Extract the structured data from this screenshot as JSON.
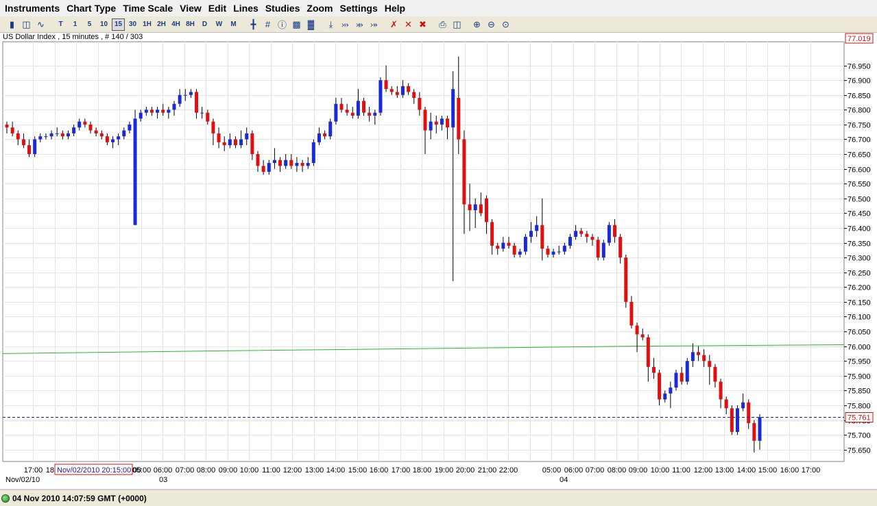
{
  "menu": [
    "Instruments",
    "Chart Type",
    "Time Scale",
    "View",
    "Edit",
    "Lines",
    "Studies",
    "Zoom",
    "Settings",
    "Help"
  ],
  "toolbar": {
    "timescale_buttons": [
      "T",
      "1",
      "5",
      "10",
      "15",
      "30",
      "1H",
      "2H",
      "4H",
      "8H",
      "D",
      "W",
      "M"
    ],
    "active_timescale": "15"
  },
  "chart_header": "US Dollar Index , 15 minutes , # 140 / 303",
  "status": {
    "text": "04 Nov 2010 14:07:59  GMT (+0000)"
  },
  "chart_data": {
    "type": "candlestick",
    "title": "US Dollar Index , 15 minutes , # 140 / 303",
    "ylim": [
      75.61,
      77.03
    ],
    "y_ticks": [
      76.95,
      76.9,
      76.85,
      76.8,
      76.75,
      76.7,
      76.65,
      76.6,
      76.55,
      76.5,
      76.45,
      76.4,
      76.35,
      76.3,
      76.25,
      76.2,
      76.15,
      76.1,
      76.05,
      76.0,
      75.95,
      75.9,
      75.85,
      75.8,
      75.75,
      75.7,
      75.65
    ],
    "x_ticks": [
      "17:00",
      "18:00",
      "",
      "",
      "",
      "05:00",
      "06:00",
      "07:00",
      "08:00",
      "09:00",
      "10:00",
      "11:00",
      "12:00",
      "13:00",
      "14:00",
      "15:00",
      "16:00",
      "17:00",
      "18:00",
      "19:00",
      "20:00",
      "21:00",
      "22:00",
      "",
      "05:00",
      "06:00",
      "07:00",
      "08:00",
      "09:00",
      "10:00",
      "11:00",
      "12:00",
      "13:00",
      "14:00",
      "15:00",
      "16:00",
      "17:00"
    ],
    "x_ticks_visible_partial": "00",
    "date_labels": [
      {
        "label": "Nov/02/10"
      },
      {
        "label": "03"
      },
      {
        "label": "04"
      }
    ],
    "cursor_label": "Nov/02/2010 20:15:00",
    "last_price": "75.761",
    "top_price": "77.019",
    "last_price_value": 75.761,
    "moving_average_color": "#22bb22",
    "moving_average": [
      75.975,
      75.984,
      75.992,
      76.0,
      76.005
    ],
    "up_color": "#1a2bd6",
    "down_color": "#e01010",
    "candles": [
      [
        76.75,
        76.76,
        76.72,
        76.74
      ],
      [
        76.74,
        76.76,
        76.71,
        76.72
      ],
      [
        76.72,
        76.73,
        76.68,
        76.7
      ],
      [
        76.7,
        76.72,
        76.67,
        76.68
      ],
      [
        76.68,
        76.7,
        76.64,
        76.65
      ],
      [
        76.65,
        76.71,
        76.64,
        76.7
      ],
      [
        76.7,
        76.72,
        76.69,
        76.71
      ],
      [
        76.71,
        76.72,
        76.7,
        76.71
      ],
      [
        76.71,
        76.73,
        76.7,
        76.72
      ],
      [
        76.72,
        76.74,
        76.71,
        76.72
      ],
      [
        76.72,
        76.73,
        76.7,
        76.71
      ],
      [
        76.71,
        76.73,
        76.7,
        76.72
      ],
      [
        76.72,
        76.75,
        76.71,
        76.74
      ],
      [
        76.74,
        76.77,
        76.73,
        76.76
      ],
      [
        76.76,
        76.77,
        76.74,
        76.75
      ],
      [
        76.75,
        76.76,
        76.72,
        76.73
      ],
      [
        76.73,
        76.74,
        76.71,
        76.72
      ],
      [
        76.72,
        76.73,
        76.7,
        76.71
      ],
      [
        76.71,
        76.72,
        76.68,
        76.69
      ],
      [
        76.69,
        76.71,
        76.67,
        76.7
      ],
      [
        76.7,
        76.72,
        76.68,
        76.71
      ],
      [
        76.71,
        76.74,
        76.7,
        76.73
      ],
      [
        76.73,
        76.76,
        76.72,
        76.75
      ],
      [
        76.41,
        76.8,
        76.41,
        76.77
      ],
      [
        76.77,
        76.8,
        76.76,
        76.79
      ],
      [
        76.79,
        76.81,
        76.78,
        76.8
      ],
      [
        76.8,
        76.81,
        76.78,
        76.79
      ],
      [
        76.79,
        76.81,
        76.77,
        76.8
      ],
      [
        76.8,
        76.82,
        76.78,
        76.79
      ],
      [
        76.79,
        76.81,
        76.77,
        76.8
      ],
      [
        76.8,
        76.83,
        76.78,
        76.82
      ],
      [
        76.82,
        76.87,
        76.81,
        76.85
      ],
      [
        76.85,
        76.87,
        76.83,
        76.85
      ],
      [
        76.85,
        76.87,
        76.84,
        76.86
      ],
      [
        76.86,
        76.87,
        76.77,
        76.79
      ],
      [
        76.79,
        76.81,
        76.77,
        76.79
      ],
      [
        76.79,
        76.8,
        76.75,
        76.76
      ],
      [
        76.76,
        76.77,
        76.68,
        76.72
      ],
      [
        76.72,
        76.74,
        76.67,
        76.69
      ],
      [
        76.69,
        76.71,
        76.66,
        76.68
      ],
      [
        76.68,
        76.72,
        76.67,
        76.7
      ],
      [
        76.7,
        76.71,
        76.67,
        76.68
      ],
      [
        76.68,
        76.73,
        76.67,
        76.7
      ],
      [
        76.7,
        76.74,
        76.68,
        76.72
      ],
      [
        76.72,
        76.73,
        76.63,
        76.65
      ],
      [
        76.65,
        76.66,
        76.59,
        76.61
      ],
      [
        76.61,
        76.63,
        76.58,
        76.59
      ],
      [
        76.59,
        76.63,
        76.58,
        76.62
      ],
      [
        76.62,
        76.67,
        76.6,
        76.63
      ],
      [
        76.63,
        76.64,
        76.59,
        76.61
      ],
      [
        76.61,
        76.65,
        76.6,
        76.63
      ],
      [
        76.63,
        76.65,
        76.6,
        76.61
      ],
      [
        76.61,
        76.64,
        76.59,
        76.62
      ],
      [
        76.62,
        76.63,
        76.59,
        76.61
      ],
      [
        76.61,
        76.64,
        76.6,
        76.62
      ],
      [
        76.62,
        76.7,
        76.61,
        76.69
      ],
      [
        76.69,
        76.74,
        76.68,
        76.72
      ],
      [
        76.72,
        76.73,
        76.7,
        76.71
      ],
      [
        76.71,
        76.77,
        76.7,
        76.76
      ],
      [
        76.76,
        76.84,
        76.75,
        76.82
      ],
      [
        76.82,
        76.84,
        76.79,
        76.8
      ],
      [
        76.8,
        76.82,
        76.78,
        76.79
      ],
      [
        76.79,
        76.81,
        76.77,
        76.78
      ],
      [
        76.78,
        76.87,
        76.77,
        76.83
      ],
      [
        76.83,
        76.84,
        76.78,
        76.79
      ],
      [
        76.79,
        76.81,
        76.76,
        76.78
      ],
      [
        76.78,
        76.8,
        76.75,
        76.79
      ],
      [
        76.79,
        76.91,
        76.78,
        76.9
      ],
      [
        76.9,
        76.95,
        76.86,
        76.87
      ],
      [
        76.87,
        76.88,
        76.85,
        76.86
      ],
      [
        76.86,
        76.88,
        76.84,
        76.85
      ],
      [
        76.85,
        76.9,
        76.84,
        76.88
      ],
      [
        76.88,
        76.89,
        76.85,
        76.86
      ],
      [
        76.86,
        76.87,
        76.82,
        76.84
      ],
      [
        76.84,
        76.86,
        76.78,
        76.8
      ],
      [
        76.8,
        76.81,
        76.65,
        76.73
      ],
      [
        76.73,
        76.79,
        76.7,
        76.76
      ],
      [
        76.76,
        76.78,
        76.72,
        76.75
      ],
      [
        76.75,
        76.78,
        76.73,
        76.77
      ],
      [
        76.77,
        76.78,
        76.7,
        76.74
      ],
      [
        76.74,
        76.93,
        76.22,
        76.87
      ],
      [
        76.84,
        76.98,
        76.65,
        76.7
      ],
      [
        76.7,
        76.73,
        76.38,
        76.48
      ],
      [
        76.48,
        76.55,
        76.39,
        76.46
      ],
      [
        76.46,
        76.5,
        76.4,
        76.48
      ],
      [
        76.48,
        76.52,
        76.44,
        76.45
      ],
      [
        76.5,
        76.51,
        76.38,
        76.42
      ],
      [
        76.42,
        76.43,
        76.31,
        76.34
      ],
      [
        76.34,
        76.35,
        76.31,
        76.33
      ],
      [
        76.33,
        76.37,
        76.32,
        76.35
      ],
      [
        76.35,
        76.37,
        76.33,
        76.34
      ],
      [
        76.34,
        76.35,
        76.3,
        76.31
      ],
      [
        76.31,
        76.33,
        76.3,
        76.32
      ],
      [
        76.32,
        76.38,
        76.31,
        76.37
      ],
      [
        76.37,
        76.42,
        76.35,
        76.39
      ],
      [
        76.39,
        76.44,
        76.37,
        76.41
      ],
      [
        76.41,
        76.5,
        76.29,
        76.33
      ],
      [
        76.33,
        76.34,
        76.3,
        76.31
      ],
      [
        76.31,
        76.33,
        76.3,
        76.32
      ],
      [
        76.32,
        76.34,
        76.31,
        76.32
      ],
      [
        76.32,
        76.35,
        76.31,
        76.34
      ],
      [
        76.34,
        76.38,
        76.33,
        76.37
      ],
      [
        76.37,
        76.41,
        76.36,
        76.39
      ],
      [
        76.39,
        76.4,
        76.37,
        76.38
      ],
      [
        76.38,
        76.39,
        76.35,
        76.37
      ],
      [
        76.37,
        76.38,
        76.34,
        76.36
      ],
      [
        76.36,
        76.37,
        76.29,
        76.3
      ],
      [
        76.3,
        76.36,
        76.29,
        76.35
      ],
      [
        76.35,
        76.42,
        76.34,
        76.41
      ],
      [
        76.41,
        76.43,
        76.35,
        76.37
      ],
      [
        76.37,
        76.38,
        76.28,
        76.3
      ],
      [
        76.3,
        76.31,
        76.13,
        76.15
      ],
      [
        76.15,
        76.17,
        76.06,
        76.07
      ],
      [
        76.07,
        76.08,
        75.98,
        76.04
      ],
      [
        76.04,
        76.06,
        76.02,
        76.03
      ],
      [
        76.03,
        76.04,
        75.88,
        75.93
      ],
      [
        75.93,
        75.96,
        75.89,
        75.91
      ],
      [
        75.91,
        75.92,
        75.8,
        75.82
      ],
      [
        75.82,
        75.85,
        75.81,
        75.84
      ],
      [
        75.84,
        75.88,
        75.79,
        75.86
      ],
      [
        75.86,
        75.92,
        75.85,
        75.91
      ],
      [
        75.91,
        75.93,
        75.87,
        75.88
      ],
      [
        75.88,
        75.96,
        75.87,
        75.95
      ],
      [
        75.95,
        76.01,
        75.93,
        75.98
      ],
      [
        75.98,
        76.0,
        75.95,
        75.97
      ],
      [
        75.97,
        75.99,
        75.93,
        75.95
      ],
      [
        75.95,
        75.97,
        75.87,
        75.93
      ],
      [
        75.93,
        75.94,
        75.86,
        75.88
      ],
      [
        75.88,
        75.89,
        75.79,
        75.82
      ],
      [
        75.82,
        75.83,
        75.77,
        75.79
      ],
      [
        75.79,
        75.8,
        75.7,
        75.71
      ],
      [
        75.71,
        75.8,
        75.7,
        75.79
      ],
      [
        75.79,
        75.84,
        75.78,
        75.81
      ],
      [
        75.81,
        75.82,
        75.72,
        75.74
      ],
      [
        75.74,
        75.75,
        75.64,
        75.68
      ],
      [
        75.68,
        75.77,
        75.65,
        75.76
      ]
    ]
  }
}
